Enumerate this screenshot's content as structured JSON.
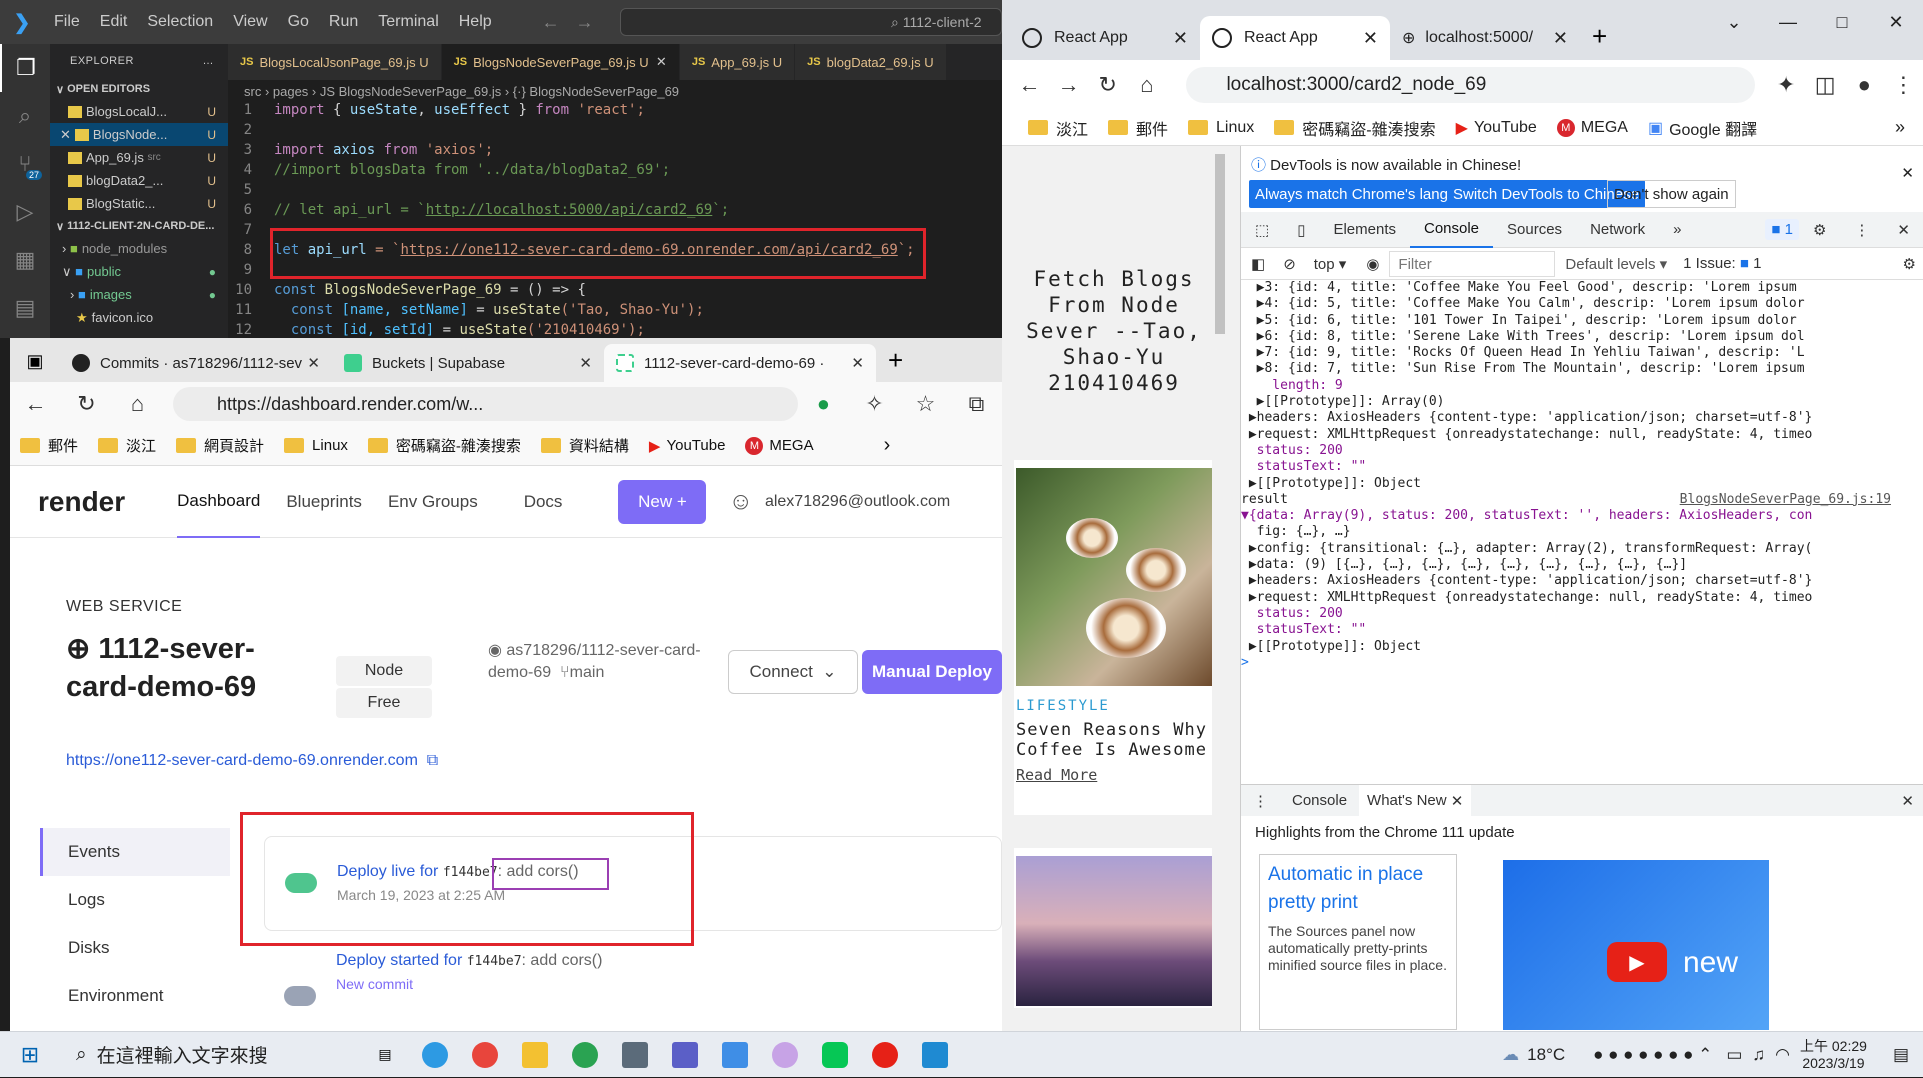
{
  "vscode": {
    "menu": [
      "File",
      "Edit",
      "Selection",
      "View",
      "Go",
      "Run",
      "Terminal",
      "Help"
    ],
    "search": "1112-client-2",
    "explorer_title": "EXPLORER",
    "open_editors_title": "OPEN EDITORS",
    "open_editors": [
      {
        "label": "BlogsLocalJ...",
        "status": "U",
        "selected": false
      },
      {
        "label": "BlogsNode...",
        "status": "U",
        "selected": true
      },
      {
        "label": "App_69.js",
        "sub": "src",
        "status": "U",
        "selected": false
      },
      {
        "label": "blogData2_...",
        "status": "U",
        "selected": false
      },
      {
        "label": "BlogStatic...",
        "status": "U",
        "selected": false
      }
    ],
    "project_title": "1112-CLIENT-2N-CARD-DE...",
    "tree": [
      "node_modules",
      "public",
      "images",
      "favicon.ico"
    ],
    "activity_badge": "27",
    "tabs": [
      {
        "label": "BlogsLocalJsonPage_69.js",
        "status": "U",
        "active": false
      },
      {
        "label": "BlogsNodeSeverPage_69.js",
        "status": "U",
        "active": true
      },
      {
        "label": "App_69.js",
        "status": "U",
        "active": false
      },
      {
        "label": "blogData2_69.js",
        "status": "U",
        "active": false
      }
    ],
    "breadcrumb": "src › pages › JS BlogsNodeSeverPage_69.js › {·} BlogsNodeSeverPage_69",
    "code": {
      "l1": {
        "n": "1",
        "a": "import",
        "b": " { ",
        "c": "useState",
        "d": ", ",
        "e": "useEffect",
        "f": " } ",
        "g": "from",
        "h": " 'react';"
      },
      "l2": {
        "n": "2"
      },
      "l3": {
        "n": "3",
        "a": "import",
        "b": " axios ",
        "c": "from",
        "d": " 'axios';"
      },
      "l4": {
        "n": "4",
        "a": "//import blogsData from '../data/blogData2_69';"
      },
      "l5": {
        "n": "5"
      },
      "l6": {
        "n": "6",
        "a": "// let api_url = `",
        "b": "http://localhost:5000/api/card2_69",
        "c": "`;"
      },
      "l7": {
        "n": "7"
      },
      "l8": {
        "n": "8",
        "a": "let ",
        "b": "api_url",
        "c": " = `",
        "d": "https://one112-sever-card-demo-69.onrender.com/api/card2_69",
        "e": "`;"
      },
      "l9": {
        "n": "9"
      },
      "l10": {
        "n": "10",
        "a": "const ",
        "b": "BlogsNodeSeverPage_69",
        "c": " = () => {"
      },
      "l11": {
        "n": "11",
        "a": "  const ",
        "b": "[name, setName]",
        "c": " = ",
        "d": "useState",
        "e": "('Tao, Shao-Yu');"
      },
      "l12": {
        "n": "12",
        "a": "  const ",
        "b": "[id, setId]",
        "c": " = ",
        "d": "useState",
        "e": "('210410469');"
      }
    }
  },
  "edge": {
    "tabs": [
      {
        "label": "Commits · as718296/1112-sev",
        "active": false
      },
      {
        "label": "Buckets | Supabase",
        "active": false
      },
      {
        "label": "1112-sever-card-demo-69 ·",
        "active": true
      }
    ],
    "url": "https://dashboard.render.com/w...",
    "bookmarks": [
      "郵件",
      "淡江",
      "網頁設計",
      "Linux",
      "密碼竊盜-雜湊搜索",
      "資料結構",
      "YouTube",
      "MEGA"
    ],
    "render": {
      "logo": "render",
      "nav": [
        "Dashboard",
        "Blueprints",
        "Env Groups",
        "Docs"
      ],
      "new_button": "New +",
      "user": "alex718296@outlook.com",
      "service_label": "WEB SERVICE",
      "service_name": "1112-sever-card-demo-69",
      "badges": [
        "Node",
        "Free"
      ],
      "repo": "as718296/1112-sever-card-demo-69",
      "branch": "main",
      "connect": "Connect",
      "manual_deploy": "Manual Deploy",
      "service_url": "https://one112-sever-card-demo-69.onrender.com",
      "sidebar": [
        "Events",
        "Logs",
        "Disks",
        "Environment"
      ],
      "events": [
        {
          "prefix": "Deploy live for",
          "commit": "f144be7",
          "msg": ": add cors()",
          "sub": "March 19, 2023 at 2:25 AM"
        },
        {
          "prefix": "Deploy started for",
          "commit": "f144be7",
          "msg": ": add cors()",
          "sub": "New commit"
        }
      ]
    }
  },
  "chrome": {
    "tabs": [
      {
        "label": "React App",
        "active": false
      },
      {
        "label": "React App",
        "active": true
      },
      {
        "label": "localhost:5000/",
        "active": false
      }
    ],
    "url": "localhost:3000/card2_node_69",
    "bookmarks": [
      "淡江",
      "郵件",
      "Linux",
      "密碼竊盜-雜湊搜索",
      "YouTube",
      "MEGA",
      "Google 翻譯"
    ],
    "page": {
      "title": "Fetch Blogs From Node Sever --Tao, Shao-Yu 210410469",
      "card_category": "LIFESTYLE",
      "card_title": "Seven Reasons Why Coffee Is Awesome",
      "card_link": "Read More"
    },
    "devtools": {
      "notice": "DevTools is now available in Chinese!",
      "btn_match": "Always match Chrome's language",
      "btn_switch": "Switch DevTools to Chinese",
      "btn_dont": "Don't show again",
      "tabs": [
        "Elements",
        "Console",
        "Sources",
        "Network"
      ],
      "issues_badge": "1",
      "context": "top",
      "filter_placeholder": "Filter",
      "levels": "Default levels",
      "issue_count": "1 Issue:",
      "issue_badge": "1",
      "console": [
        "  ▶3: {id: 4, title: 'Coffee Make You Feel Good', descrip: 'Lorem ipsum",
        "  ▶4: {id: 5, title: 'Coffee Make You Calm', descrip: 'Lorem ipsum dolor",
        "  ▶5: {id: 6, title: '101 Tower In Taipei', descrip: 'Lorem ipsum dolor",
        "  ▶6: {id: 8, title: 'Serene Lake With Trees', descrip: 'Lorem ipsum dol",
        "  ▶7: {id: 9, title: 'Rocks Of Queen Head In Yehliu Taiwan', descrip: 'L",
        "  ▶8: {id: 7, title: 'Sun Rise From The Mountain', descrip: 'Lorem ipsum",
        "    length: 9",
        "  ▶[[Prototype]]: Array(0)",
        " ▶headers: AxiosHeaders {content-type: 'application/json; charset=utf-8'}",
        " ▶request: XMLHttpRequest {onreadystatechange: null, readyState: 4, timeo",
        "  status: 200",
        "  statusText: \"\"",
        " ▶[[Prototype]]: Object",
        "result",
        "▼{data: Array(9), status: 200, statusText: '', headers: AxiosHeaders, con",
        "  fig: {…}, …}",
        " ▶config: {transitional: {…}, adapter: Array(2), transformRequest: Array(",
        " ▶data: (9) [{…}, {…}, {…}, {…}, {…}, {…}, {…}, {…}, {…}]",
        " ▶headers: AxiosHeaders {content-type: 'application/json; charset=utf-8'}",
        " ▶request: XMLHttpRequest {onreadystatechange: null, readyState: 4, timeo",
        "  status: 200",
        "  statusText: \"\"",
        " ▶[[Prototype]]: Object",
        ">"
      ],
      "source_link": "BlogsNodeSeverPage_69.js:19",
      "bottom_tabs": [
        "Console",
        "What's New"
      ],
      "whats_new_heading": "Highlights from the Chrome 111 update",
      "card_heading": "Automatic in place pretty print",
      "card_text": "The Sources panel now automatically pretty-prints minified source files in place.",
      "video_label": "new"
    }
  },
  "taskbar": {
    "search": "在這裡輸入文字來搜",
    "weather": "18°C",
    "time": "上午 02:29",
    "date": "2023/3/19"
  },
  "colors": {
    "accent_render": "#7e6cf6",
    "highlight_red": "#e0242b",
    "highlight_purple": "#9b3fb3",
    "devtools_blue": "#1a73e8"
  }
}
